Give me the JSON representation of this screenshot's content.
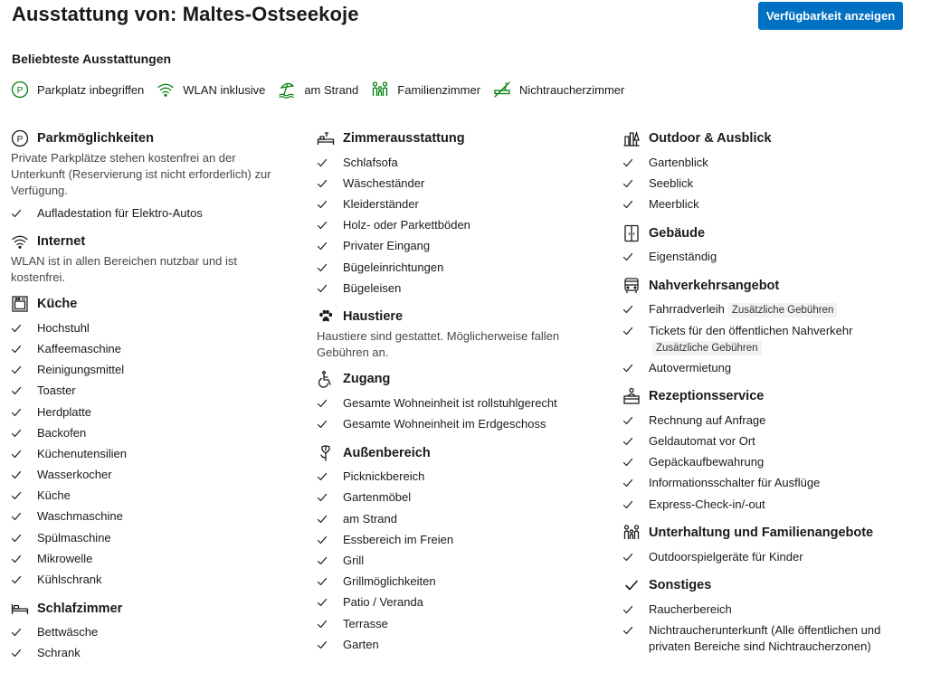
{
  "header": {
    "title": "Ausstattung von: Maltes-Ostseekoje",
    "availability_button": "Verfügbarkeit anzeigen"
  },
  "popular": {
    "title": "Beliebteste Ausstattungen",
    "items": [
      {
        "label": "Parkplatz inbegriffen",
        "icon": "parking-icon"
      },
      {
        "label": "WLAN inklusive",
        "icon": "wifi-icon"
      },
      {
        "label": "am Strand",
        "icon": "beach-icon"
      },
      {
        "label": "Familienzimmer",
        "icon": "family-icon"
      },
      {
        "label": "Nichtraucherzimmer",
        "icon": "no-smoking-icon"
      }
    ],
    "accent_color": "#008009"
  },
  "sections": {
    "parking": {
      "title": "Parkmöglichkeiten",
      "desc": "Private Parkplätze stehen kostenfrei an der Unterkunft (Reservierung ist nicht erforderlich) zur Verfügung.",
      "items": [
        "Aufladestation für Elektro-Autos"
      ]
    },
    "internet": {
      "title": "Internet",
      "desc": "WLAN ist in allen Bereichen nutzbar und ist kostenfrei."
    },
    "kitchen": {
      "title": "Küche",
      "items": [
        "Hochstuhl",
        "Kaffeemaschine",
        "Reinigungsmittel",
        "Toaster",
        "Herdplatte",
        "Backofen",
        "Küchenutensilien",
        "Wasserkocher",
        "Küche",
        "Waschmaschine",
        "Spülmaschine",
        "Mikrowelle",
        "Kühlschrank"
      ]
    },
    "bedroom": {
      "title": "Schlafzimmer",
      "items": [
        "Bettwäsche",
        "Schrank"
      ]
    },
    "room": {
      "title": "Zimmerausstattung",
      "items": [
        "Schlafsofa",
        "Wäscheständer",
        "Kleiderständer",
        "Holz- oder Parkettböden",
        "Privater Eingang",
        "Bügeleinrichtungen",
        "Bügeleisen"
      ]
    },
    "pets": {
      "title": "Haustiere",
      "desc": "Haustiere sind gestattet. Möglicherweise fallen Gebühren an."
    },
    "access": {
      "title": "Zugang",
      "items": [
        "Gesamte Wohneinheit ist rollstuhlgerecht",
        "Gesamte Wohneinheit im Erdgeschoss"
      ]
    },
    "outdoor": {
      "title": "Außenbereich",
      "items": [
        "Picknickbereich",
        "Gartenmöbel",
        "am Strand",
        "Essbereich im Freien",
        "Grill",
        "Grillmöglichkeiten",
        "Patio / Veranda",
        "Terrasse",
        "Garten"
      ]
    },
    "view": {
      "title": "Outdoor & Ausblick",
      "items": [
        "Gartenblick",
        "Seeblick",
        "Meerblick"
      ]
    },
    "building": {
      "title": "Gebäude",
      "items": [
        "Eigenständig"
      ]
    },
    "transport": {
      "title": "Nahverkehrsangebot",
      "items": [
        {
          "label": "Fahrradverleih",
          "badge": "Zusätzliche Gebühren"
        },
        {
          "label": "Tickets für den öffentlichen Nahverkehr",
          "badge": "Zusätzliche Gebühren"
        },
        {
          "label": "Autovermietung",
          "badge": ""
        }
      ]
    },
    "reception": {
      "title": "Rezeptionsservice",
      "items": [
        "Rechnung auf Anfrage",
        "Geldautomat vor Ort",
        "Gepäckaufbewahrung",
        "Informationsschalter für Ausflüge",
        "Express-Check-in/-out"
      ]
    },
    "entertainment": {
      "title": "Unterhaltung und Familienangebote",
      "items": [
        "Outdoorspielgeräte für Kinder"
      ]
    },
    "misc": {
      "title": "Sonstiges",
      "items": [
        "Raucherbereich",
        "Nichtraucherunterkunft (Alle öffentlichen und privaten Bereiche sind Nichtraucherzonen)"
      ]
    }
  },
  "colors": {
    "primary_button": "#0071c2",
    "text": "#1a1a1a",
    "badge_bg": "#f2f2f2"
  }
}
